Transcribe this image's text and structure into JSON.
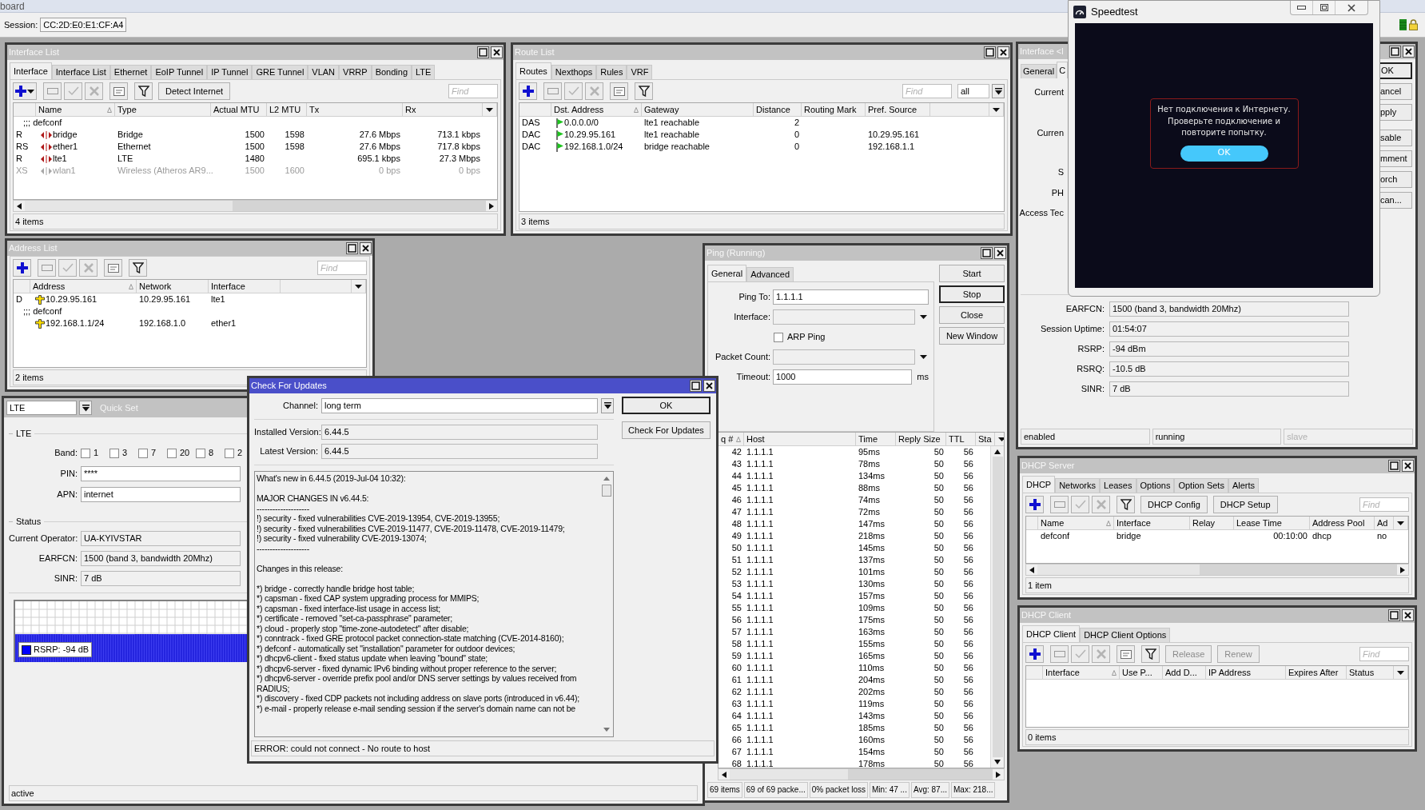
{
  "app": {
    "title": "board"
  },
  "session": {
    "label": "Session:",
    "value": "CC:2D:E0:E1:CF:A4"
  },
  "interface_list": {
    "title": "Interface List",
    "active": false,
    "tabs": [
      {
        "label": "Interface",
        "selected": true
      },
      {
        "label": "Interface List",
        "selected": false
      },
      {
        "label": "Ethernet",
        "selected": false
      },
      {
        "label": "EoIP Tunnel",
        "selected": false
      },
      {
        "label": "IP Tunnel",
        "selected": false
      },
      {
        "label": "GRE Tunnel",
        "selected": false
      },
      {
        "label": "VLAN",
        "selected": false
      },
      {
        "label": "VRRP",
        "selected": false
      },
      {
        "label": "Bonding",
        "selected": false
      },
      {
        "label": "LTE",
        "selected": false
      }
    ],
    "buttons": [
      {
        "label": "Detect Internet",
        "disabled": false
      }
    ],
    "placeholder": "Find",
    "columns": [
      {
        "label": "Name",
        "sorted": true
      },
      {
        "label": "Type",
        "sorted": false
      },
      {
        "label": "Actual MTU",
        "sorted": false
      },
      {
        "label": "L2 MTU",
        "sorted": false
      },
      {
        "label": "Tx",
        "sorted": false
      },
      {
        "label": "Rx",
        "sorted": false
      }
    ],
    "rows": [
      {
        "kind": "comment",
        "text": ";;; defconf"
      },
      {
        "kind": "item",
        "flags": "R",
        "cells": [
          "bridge",
          "Bridge",
          "1500",
          "1598",
          "27.6 Mbps",
          "713.1 kbps"
        ],
        "disabled": false
      },
      {
        "kind": "item",
        "flags": "RS",
        "cells": [
          "ether1",
          "Ethernet",
          "1500",
          "1598",
          "27.6 Mbps",
          "717.8 kbps"
        ],
        "disabled": false
      },
      {
        "kind": "item",
        "flags": "R",
        "cells": [
          "lte1",
          "LTE",
          "1480",
          null,
          "695.1 kbps",
          "27.3 Mbps"
        ],
        "disabled": false
      },
      {
        "kind": "item",
        "flags": "XS",
        "cells": [
          "wlan1",
          "Wireless (Atheros AR9...",
          "1500",
          "1600",
          "0 bps",
          "0 bps"
        ],
        "disabled": true
      }
    ],
    "status": [
      "4 items"
    ]
  },
  "address_list": {
    "title": "Address List",
    "active": false,
    "placeholder": "Find",
    "columns": [
      {
        "label": "Address",
        "sorted": true
      },
      {
        "label": "Network",
        "sorted": false
      },
      {
        "label": "Interface",
        "sorted": false
      }
    ],
    "rows": [
      {
        "kind": "item",
        "flags": "D",
        "cells": [
          "10.29.95.161",
          "10.29.95.161",
          "lte1"
        ]
      },
      {
        "kind": "comment",
        "text": ";;; defconf"
      },
      {
        "kind": "item",
        "cells": [
          "192.168.1.1/24",
          "192.168.1.0",
          "ether1"
        ]
      }
    ],
    "status": [
      "2 items"
    ]
  },
  "quick_set": {
    "title": "Quick Set",
    "active": false,
    "mode": "LTE",
    "sections": [
      {
        "label": "LTE"
      },
      {
        "label": "Status"
      }
    ],
    "band": {
      "label": "Band:",
      "options": [
        {
          "label": "1",
          "checked": false
        },
        {
          "label": "3",
          "checked": false
        },
        {
          "label": "7",
          "checked": false
        },
        {
          "label": "20",
          "checked": false
        },
        {
          "label": "8",
          "checked": false
        },
        {
          "label": "2",
          "checked": false
        }
      ]
    },
    "inputs": [
      {
        "label": "PIN:",
        "value": "****"
      },
      {
        "label": "APN:",
        "value": "internet"
      }
    ],
    "readouts": [
      {
        "label": "Current Operator:",
        "value": "UA-KYIVSTAR"
      },
      {
        "label": "EARFCN:",
        "value": "1500 (band 3, bandwidth 20Mhz)"
      },
      {
        "label": "SINR:",
        "value": "7 dB"
      }
    ],
    "graph": {
      "legend": "RSRP: -94 dB"
    },
    "status": [
      "active"
    ]
  },
  "route_list": {
    "title": "Route List",
    "active": false,
    "tabs": [
      {
        "label": "Routes",
        "selected": true
      },
      {
        "label": "Nexthops",
        "selected": false
      },
      {
        "label": "Rules",
        "selected": false
      },
      {
        "label": "VRF",
        "selected": false
      }
    ],
    "placeholder": "Find",
    "scope": "all",
    "columns": [
      {
        "label": "Dst. Address",
        "sorted": true
      },
      {
        "label": "Gateway",
        "sorted": false
      },
      {
        "label": "Distance",
        "sorted": false
      },
      {
        "label": "Routing Mark",
        "sorted": false
      },
      {
        "label": "Pref. Source",
        "sorted": false
      }
    ],
    "rows": [
      {
        "flags": "DAS",
        "cells": [
          "0.0.0.0/0",
          "lte1 reachable",
          "2",
          null,
          null
        ]
      },
      {
        "flags": "DAC",
        "cells": [
          "10.29.95.161",
          "lte1 reachable",
          "0",
          null,
          "10.29.95.161"
        ]
      },
      {
        "flags": "DAC",
        "cells": [
          "192.168.1.0/24",
          "bridge reachable",
          "0",
          null,
          "192.168.1.1"
        ]
      }
    ],
    "status": [
      "3 items"
    ]
  },
  "ping": {
    "title": "Ping (Running)",
    "active": false,
    "tabs": [
      {
        "label": "General",
        "selected": true
      },
      {
        "label": "Advanced",
        "selected": false
      }
    ],
    "fields": [
      {
        "kind": "text",
        "label": "Ping To:",
        "value": "1.1.1.1"
      },
      {
        "kind": "select",
        "label": "Interface:"
      },
      {
        "kind": "checkbox",
        "label": "ARP Ping",
        "checked": false
      },
      {
        "kind": "select",
        "label": "Packet Count:"
      },
      {
        "kind": "text",
        "label": "Timeout:",
        "value": "1000",
        "unit": "ms"
      }
    ],
    "buttons": [
      {
        "label": "Start",
        "default": false
      },
      {
        "label": "Stop",
        "default": true
      },
      {
        "label": "Close",
        "default": false
      },
      {
        "label": "New Window",
        "default": false
      }
    ],
    "columns": [
      {
        "label": "q #",
        "sorted": true
      },
      {
        "label": "Host",
        "sorted": false
      },
      {
        "label": "Time",
        "sorted": false
      },
      {
        "label": "Reply Size",
        "sorted": false
      },
      {
        "label": "TTL",
        "sorted": false
      },
      {
        "label": "Sta",
        "sorted": false
      }
    ],
    "rows": [
      {
        "cells": [
          "42",
          "1.1.1.1",
          "95ms",
          "50",
          "56"
        ]
      },
      {
        "cells": [
          "43",
          "1.1.1.1",
          "78ms",
          "50",
          "56"
        ]
      },
      {
        "cells": [
          "44",
          "1.1.1.1",
          "134ms",
          "50",
          "56"
        ]
      },
      {
        "cells": [
          "45",
          "1.1.1.1",
          "88ms",
          "50",
          "56"
        ]
      },
      {
        "cells": [
          "46",
          "1.1.1.1",
          "74ms",
          "50",
          "56"
        ]
      },
      {
        "cells": [
          "47",
          "1.1.1.1",
          "72ms",
          "50",
          "56"
        ]
      },
      {
        "cells": [
          "48",
          "1.1.1.1",
          "147ms",
          "50",
          "56"
        ]
      },
      {
        "cells": [
          "49",
          "1.1.1.1",
          "218ms",
          "50",
          "56"
        ]
      },
      {
        "cells": [
          "50",
          "1.1.1.1",
          "145ms",
          "50",
          "56"
        ]
      },
      {
        "cells": [
          "51",
          "1.1.1.1",
          "137ms",
          "50",
          "56"
        ]
      },
      {
        "cells": [
          "52",
          "1.1.1.1",
          "101ms",
          "50",
          "56"
        ]
      },
      {
        "cells": [
          "53",
          "1.1.1.1",
          "130ms",
          "50",
          "56"
        ]
      },
      {
        "cells": [
          "54",
          "1.1.1.1",
          "157ms",
          "50",
          "56"
        ]
      },
      {
        "cells": [
          "55",
          "1.1.1.1",
          "109ms",
          "50",
          "56"
        ]
      },
      {
        "cells": [
          "56",
          "1.1.1.1",
          "175ms",
          "50",
          "56"
        ]
      },
      {
        "cells": [
          "57",
          "1.1.1.1",
          "163ms",
          "50",
          "56"
        ]
      },
      {
        "cells": [
          "58",
          "1.1.1.1",
          "155ms",
          "50",
          "56"
        ]
      },
      {
        "cells": [
          "59",
          "1.1.1.1",
          "165ms",
          "50",
          "56"
        ]
      },
      {
        "cells": [
          "60",
          "1.1.1.1",
          "110ms",
          "50",
          "56"
        ]
      },
      {
        "cells": [
          "61",
          "1.1.1.1",
          "204ms",
          "50",
          "56"
        ]
      },
      {
        "cells": [
          "62",
          "1.1.1.1",
          "202ms",
          "50",
          "56"
        ]
      },
      {
        "cells": [
          "63",
          "1.1.1.1",
          "119ms",
          "50",
          "56"
        ]
      },
      {
        "cells": [
          "64",
          "1.1.1.1",
          "143ms",
          "50",
          "56"
        ]
      },
      {
        "cells": [
          "65",
          "1.1.1.1",
          "185ms",
          "50",
          "56"
        ]
      },
      {
        "cells": [
          "66",
          "1.1.1.1",
          "160ms",
          "50",
          "56"
        ]
      },
      {
        "cells": [
          "67",
          "1.1.1.1",
          "154ms",
          "50",
          "56"
        ]
      },
      {
        "cells": [
          "68",
          "1.1.1.1",
          "178ms",
          "50",
          "56"
        ]
      }
    ],
    "status": [
      "69 items",
      "69 of 69 packe...",
      "0% packet loss",
      "Min: 47 ...",
      "Avg: 87...",
      "Max: 218..."
    ]
  },
  "check_for_updates": {
    "title": "Check For Updates",
    "active": true,
    "channel": {
      "label": "Channel:",
      "value": "long term"
    },
    "versions": [
      {
        "label": "Installed Version:",
        "value": "6.44.5"
      },
      {
        "label": "Latest Version:",
        "value": "6.44.5"
      }
    ],
    "buttons": [
      {
        "label": "OK",
        "default": true
      },
      {
        "label": "Check For Updates",
        "default": false
      }
    ],
    "changelog": [
      [
        "What's new in 6.44.5 (2019-Jul-04 10:32):"
      ],
      [
        "MAJOR CHANGES IN v6.44.5:",
        "--------------------",
        "!) security - fixed vulnerabilities CVE-2019-13954, CVE-2019-13955;",
        "!) security - fixed vulnerabilities CVE-2019-11477, CVE-2019-11478, CVE-2019-11479;",
        "!) security - fixed vulnerability CVE-2019-13074;",
        "--------------------"
      ],
      [
        "Changes in this release:"
      ],
      [
        "*) bridge - correctly handle bridge host table;",
        "*) capsman - fixed CAP system upgrading process for MMIPS;",
        "*) capsman - fixed interface-list usage in access list;",
        "*) certificate - removed \"set-ca-passphrase\" parameter;",
        "*) cloud - properly stop \"time-zone-autodetect\" after disable;",
        "*) conntrack - fixed GRE protocol packet connection-state matching (CVE-2014-8160);",
        "*) defconf - automatically set \"installation\" parameter for outdoor devices;",
        "*) dhcpv6-client - fixed status update when leaving \"bound\" state;",
        "*) dhcpv6-server - fixed dynamic IPv6 binding without proper reference to the server;",
        "*) dhcpv6-server - override prefix pool and/or DNS server settings by values received from RADIUS;",
        "*) discovery - fixed CDP packets not including address on slave ports (introduced in v6.44);",
        "*) e-mail - properly release e-mail sending session if the server's domain name can not be"
      ]
    ],
    "status": "ERROR: could not connect - No route to host"
  },
  "interface_lte": {
    "title": "Interface <l",
    "active": false,
    "tabs": [
      {
        "label": "General",
        "selected": false
      },
      {
        "label": "C",
        "selected": true
      }
    ],
    "partial_labels": [
      "Current",
      "Curren",
      "S",
      "PH",
      "Access Tec"
    ],
    "fields": [
      {
        "label": "EARFCN:",
        "value": "1500 (band 3, bandwidth 20Mhz)"
      },
      {
        "label": "Session Uptime:",
        "value": "01:54:07"
      },
      {
        "label": "RSRP:",
        "value": "-94 dBm"
      },
      {
        "label": "RSRQ:",
        "value": "-10.5 dB"
      },
      {
        "label": "SINR:",
        "value": "7 dB"
      }
    ],
    "buttons": [
      {
        "label": "OK",
        "default": true
      },
      {
        "label": "ancel",
        "default": false
      },
      {
        "label": "pply",
        "default": false
      },
      {
        "label": "sable",
        "default": false
      },
      {
        "label": "mment",
        "default": false
      },
      {
        "label": "orch",
        "default": false
      },
      {
        "label": "can...",
        "default": false
      }
    ],
    "status": [
      {
        "text": "enabled",
        "disabled": false
      },
      {
        "text": "running",
        "disabled": false
      },
      {
        "text": "slave",
        "disabled": true
      }
    ]
  },
  "speedtest": {
    "title": "Speedtest",
    "message": "Нет подключения к Интернету. Проверьте подключение и повторите попытку.",
    "button": "OK"
  },
  "dhcp_server": {
    "title": "DHCP Server",
    "active": false,
    "tabs": [
      {
        "label": "DHCP",
        "selected": true
      },
      {
        "label": "Networks",
        "selected": false
      },
      {
        "label": "Leases",
        "selected": false
      },
      {
        "label": "Options",
        "selected": false
      },
      {
        "label": "Option Sets",
        "selected": false
      },
      {
        "label": "Alerts",
        "selected": false
      }
    ],
    "buttons": [
      {
        "label": "DHCP Config",
        "disabled": false
      },
      {
        "label": "DHCP Setup",
        "disabled": false
      }
    ],
    "placeholder": "Find",
    "columns": [
      {
        "label": "Name",
        "sorted": true
      },
      {
        "label": "Interface",
        "sorted": false
      },
      {
        "label": "Relay",
        "sorted": false
      },
      {
        "label": "Lease Time",
        "sorted": false
      },
      {
        "label": "Address Pool",
        "sorted": false
      },
      {
        "label": "Ad",
        "sorted": false
      }
    ],
    "rows": [
      {
        "cells": [
          "defconf",
          "bridge",
          null,
          "00:10:00",
          "dhcp",
          "no"
        ]
      }
    ],
    "status": [
      "1 item"
    ]
  },
  "dhcp_client": {
    "title": "DHCP Client",
    "active": false,
    "tabs": [
      {
        "label": "DHCP Client",
        "selected": true
      },
      {
        "label": "DHCP Client Options",
        "selected": false
      }
    ],
    "buttons": [
      {
        "label": "Release",
        "disabled": true
      },
      {
        "label": "Renew",
        "disabled": true
      }
    ],
    "placeholder": "Find",
    "columns": [
      {
        "label": "Interface",
        "sorted": true
      },
      {
        "label": "Use P...",
        "sorted": false
      },
      {
        "label": "Add D...",
        "sorted": false
      },
      {
        "label": "IP Address",
        "sorted": false
      },
      {
        "label": "Expires After",
        "sorted": false
      },
      {
        "label": "Status",
        "sorted": false
      }
    ],
    "status": [
      "0 items"
    ]
  }
}
